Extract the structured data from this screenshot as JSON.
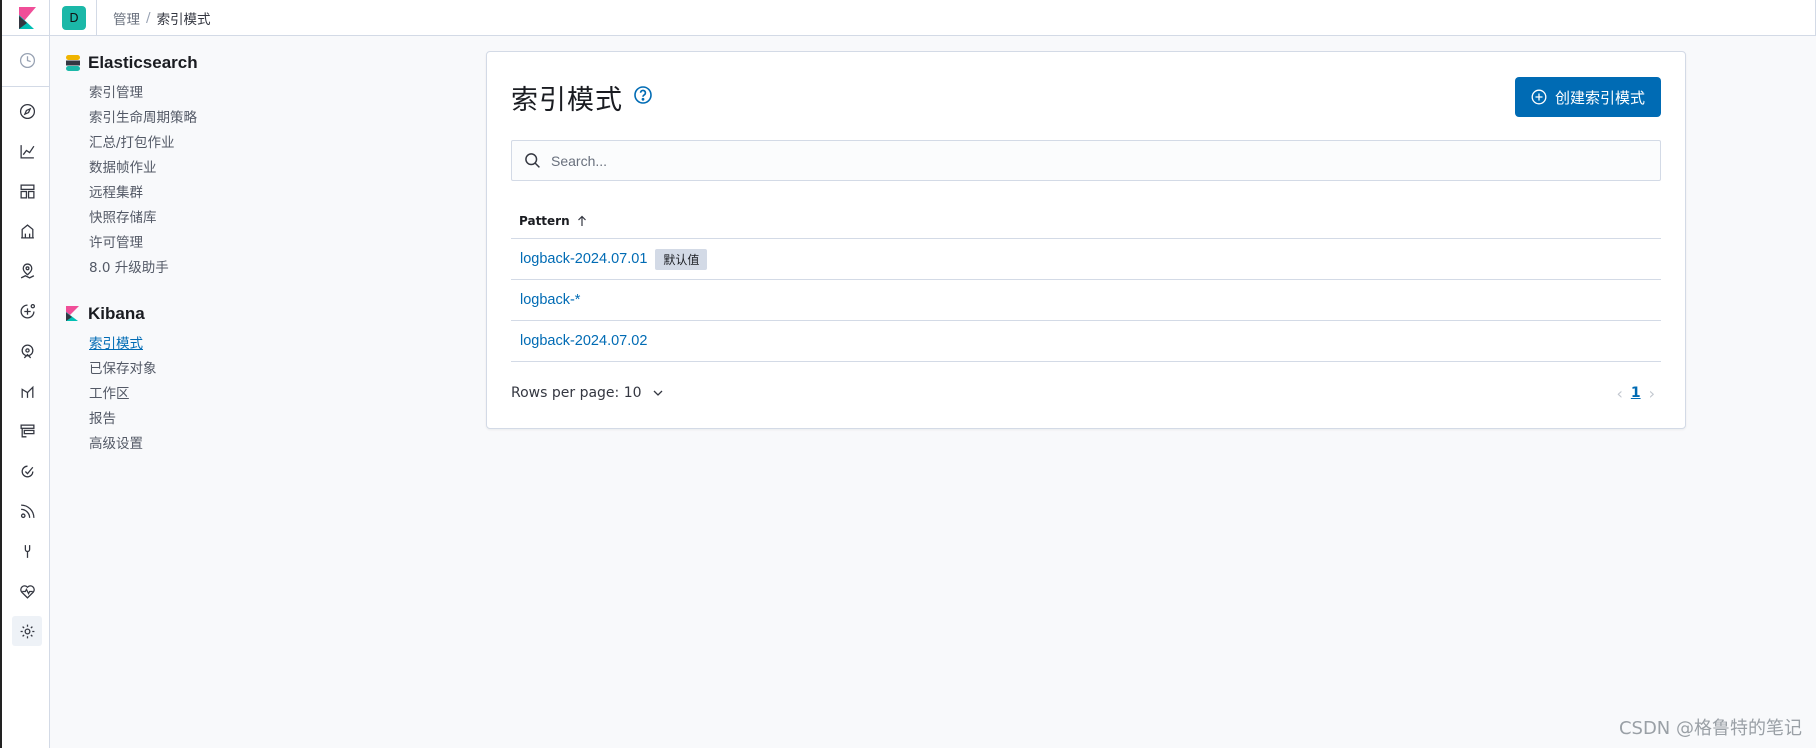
{
  "header": {
    "space_initial": "D",
    "breadcrumbs": [
      {
        "label": "管理"
      },
      {
        "label": "索引模式"
      }
    ],
    "separator": "/"
  },
  "rail": {
    "icons": [
      "clock-icon",
      "compass-icon",
      "visualize-icon",
      "dashboard-icon",
      "canvas-icon",
      "maps-icon",
      "ml-icon",
      "siem-icon",
      "apm-icon",
      "uptime-icon",
      "infra-icon",
      "logs-icon",
      "devtools-icon",
      "monitoring-icon",
      "management-icon"
    ]
  },
  "sidenav": {
    "elasticsearch": {
      "title": "Elasticsearch",
      "items": [
        "索引管理",
        "索引生命周期策略",
        "汇总/打包作业",
        "数据帧作业",
        "远程集群",
        "快照存储库",
        "许可管理",
        "8.0 升级助手"
      ]
    },
    "kibana": {
      "title": "Kibana",
      "items": [
        "索引模式",
        "已保存对象",
        "工作区",
        "报告",
        "高级设置"
      ],
      "selected_index": 0
    }
  },
  "main": {
    "title": "索引模式",
    "create_button": "创建索引模式",
    "search_placeholder": "Search...",
    "table": {
      "column": "Pattern",
      "rows": [
        {
          "pattern": "logback-2024.07.01",
          "badge": "默认值"
        },
        {
          "pattern": "logback-*",
          "badge": ""
        },
        {
          "pattern": "logback-2024.07.02",
          "badge": ""
        }
      ]
    },
    "rows_per_page": "Rows per page: 10",
    "current_page": "1"
  },
  "watermark": "CSDN @格鲁特的笔记",
  "colors": {
    "accent": "#006bb4",
    "space_avatar": "#1bb8a8",
    "border": "#d3dae6"
  }
}
